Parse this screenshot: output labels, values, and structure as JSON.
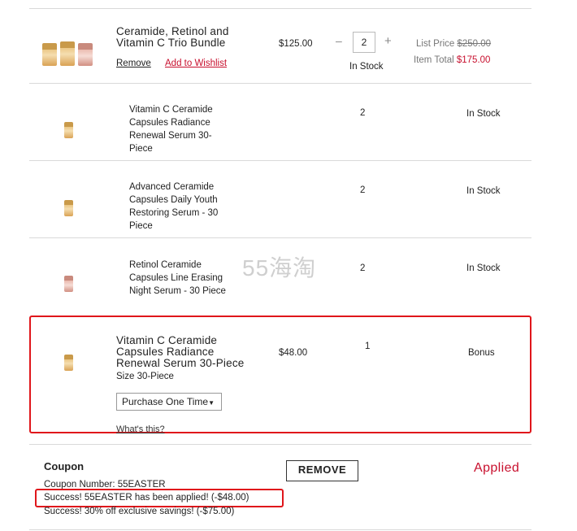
{
  "bundle": {
    "title_line1": "Ceramide, Retinol and",
    "title_line2": "Vitamin C Trio Bundle",
    "remove_label": "Remove",
    "wishlist_label": "Add to Wishlist",
    "price": "$125.00",
    "qty_minus": "–",
    "qty_value": "2",
    "qty_plus": "+",
    "stock": "In Stock",
    "list_price_label": "List Price",
    "list_price_value": "$250.00",
    "item_total_label": "Item Total",
    "item_total_value": "$175.00"
  },
  "components": [
    {
      "lines": [
        "Vitamin C Ceramide",
        "Capsules Radiance",
        "Renewal Serum 30-",
        "Piece"
      ],
      "qty": "2",
      "stock": "In Stock"
    },
    {
      "lines": [
        "Advanced Ceramide",
        "Capsules Daily Youth",
        "Restoring Serum - 30",
        "Piece"
      ],
      "qty": "2",
      "stock": "In Stock"
    },
    {
      "lines": [
        "Retinol Ceramide",
        "Capsules Line Erasing",
        "Night Serum - 30 Piece"
      ],
      "qty": "2",
      "stock": "In Stock"
    }
  ],
  "bonus": {
    "title_line1": "Vitamin C Ceramide",
    "title_line2": "Capsules Radiance",
    "title_line3": "Renewal Serum 30-Piece",
    "size": "Size 30-Piece",
    "price": "$48.00",
    "qty": "1",
    "status": "Bonus",
    "purchase_option": "Purchase One Time",
    "whats_this": "What's this?"
  },
  "coupon": {
    "heading": "Coupon",
    "number_text": "Coupon Number: 55EASTER",
    "success1": "Success! 55EASTER has been applied! (-$48.00)",
    "success2": "Success! 30% off exclusive savings! (-$75.00)",
    "remove_button": "REMOVE",
    "applied": "Applied"
  },
  "watermark": "55海淘",
  "colors": {
    "accent_red": "#c8102e",
    "highlight_box": "#e0161b"
  }
}
